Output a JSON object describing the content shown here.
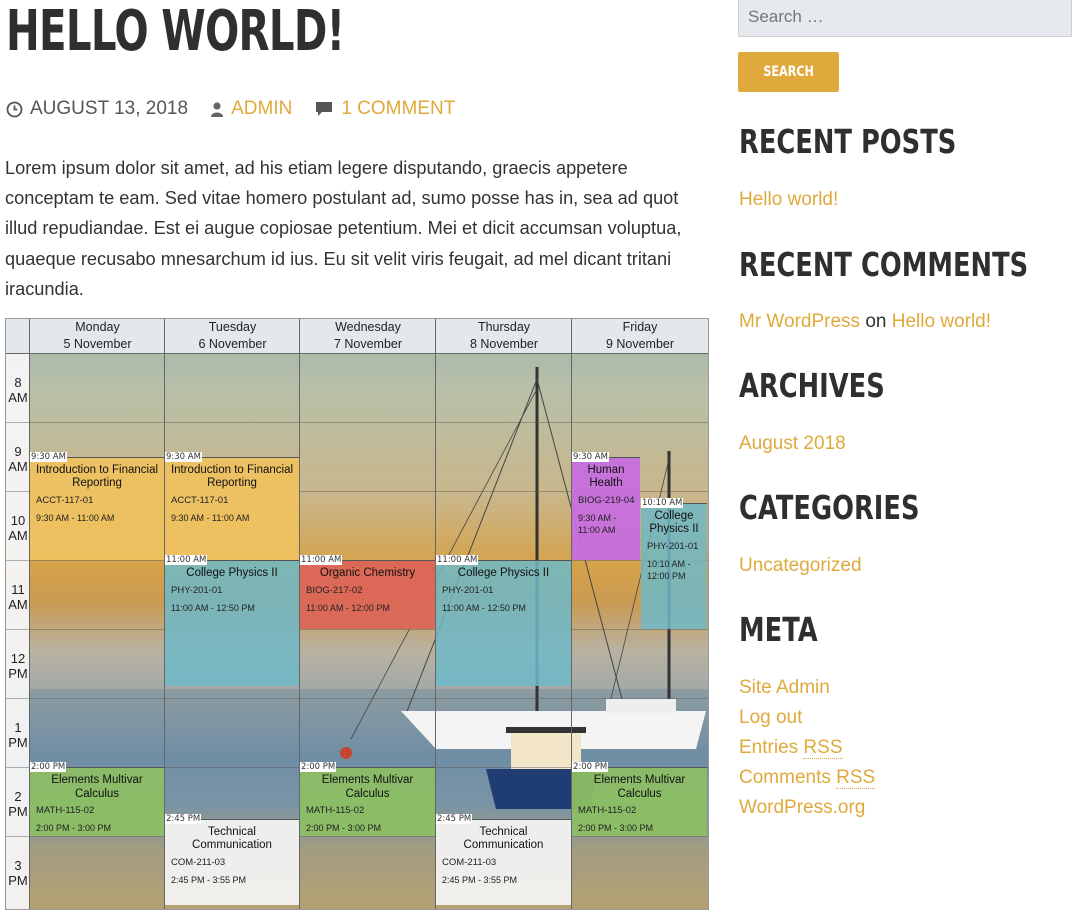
{
  "post": {
    "title": "HELLO WORLD!",
    "date": "AUGUST 13, 2018",
    "author": "ADMIN",
    "comments": "1 COMMENT",
    "content": "Lorem ipsum dolor sit amet, ad his etiam legere disputando, graecis appetere conceptam te eam. Sed vitae homero postulant ad, sumo posse has in, sea ad quot illud repudiandae. Est ei augue copiosae petentium. Mei et dicit accumsan voluptua, quaeque recusabo mnesarchum id ius. Eu sit velit viris feugait, ad mel dicant tritani iracundia."
  },
  "timetable": {
    "days": [
      {
        "name": "Monday",
        "date": "5 November"
      },
      {
        "name": "Tuesday",
        "date": "6 November"
      },
      {
        "name": "Wednesday",
        "date": "7 November"
      },
      {
        "name": "Thursday",
        "date": "8 November"
      },
      {
        "name": "Friday",
        "date": "9 November"
      }
    ],
    "hours": [
      {
        "h": "8",
        "p": "AM"
      },
      {
        "h": "9",
        "p": "AM"
      },
      {
        "h": "10",
        "p": "AM"
      },
      {
        "h": "11",
        "p": "AM"
      },
      {
        "h": "12",
        "p": "PM"
      },
      {
        "h": "1",
        "p": "PM"
      },
      {
        "h": "2",
        "p": "PM"
      },
      {
        "h": "3",
        "p": "PM"
      }
    ],
    "events": [
      {
        "day": 0,
        "start": 9.5,
        "end": 11,
        "stamp": "9:30 AM",
        "title": "Introduction to Financial Reporting",
        "code": "ACCT-117-01",
        "time": "9:30 AM - 11:00 AM",
        "color": "gold"
      },
      {
        "day": 1,
        "start": 9.5,
        "end": 11,
        "stamp": "9:30 AM",
        "title": "Introduction to Financial Reporting",
        "code": "ACCT-117-01",
        "time": "9:30 AM - 11:00 AM",
        "color": "gold"
      },
      {
        "day": 1,
        "start": 11,
        "end": 12.833,
        "stamp": "11:00 AM",
        "title": "College Physics II",
        "code": "PHY-201-01",
        "time": "11:00 AM - 12:50 PM",
        "color": "teal"
      },
      {
        "day": 2,
        "start": 11,
        "end": 12,
        "stamp": "11:00 AM",
        "title": "Organic Chemistry",
        "code": "BIOG-217-02",
        "time": "11:00 AM - 12:00 PM",
        "color": "red"
      },
      {
        "day": 3,
        "start": 11,
        "end": 12.833,
        "stamp": "11:00 AM",
        "title": "College Physics II",
        "code": "PHY-201-01",
        "time": "11:00 AM - 12:50 PM",
        "color": "teal"
      },
      {
        "day": 4,
        "half": "left",
        "start": 9.5,
        "end": 11,
        "stamp": "9:30 AM",
        "title": "Human Health",
        "code": "BIOG-219-04",
        "time": "9:30 AM - 11:00 AM",
        "color": "purple"
      },
      {
        "day": 4,
        "half": "right",
        "start": 10.167,
        "end": 12,
        "stamp": "10:10 AM",
        "title": "College Physics II",
        "code": "PHY-201-01",
        "time": "10:10 AM - 12:00 PM",
        "color": "teal"
      },
      {
        "day": 0,
        "start": 14,
        "end": 15,
        "stamp": "2:00 PM",
        "title": "Elements Multivar Calculus",
        "code": "MATH-115-02",
        "time": "2:00 PM - 3:00 PM",
        "color": "green"
      },
      {
        "day": 2,
        "start": 14,
        "end": 15,
        "stamp": "2:00 PM",
        "title": "Elements Multivar Calculus",
        "code": "MATH-115-02",
        "time": "2:00 PM - 3:00 PM",
        "color": "green"
      },
      {
        "day": 4,
        "start": 14,
        "end": 15,
        "stamp": "2:00 PM",
        "title": "Elements Multivar Calculus",
        "code": "MATH-115-02",
        "time": "2:00 PM - 3:00 PM",
        "color": "green"
      },
      {
        "day": 1,
        "start": 14.75,
        "end": 16,
        "stamp": "2:45 PM",
        "title": "Technical Communication",
        "code": "COM-211-03",
        "time": "2:45 PM - 3:55 PM",
        "color": "white"
      },
      {
        "day": 3,
        "start": 14.75,
        "end": 16,
        "stamp": "2:45 PM",
        "title": "Technical Communication",
        "code": "COM-211-03",
        "time": "2:45 PM - 3:55 PM",
        "color": "white"
      }
    ]
  },
  "sidebar": {
    "search_placeholder": "Search …",
    "search_button": "SEARCH",
    "recent_posts_title": "RECENT POSTS",
    "recent_posts": [
      "Hello world!"
    ],
    "recent_comments_title": "RECENT COMMENTS",
    "comment_author": "Mr WordPress",
    "comment_on": "on",
    "comment_post": "Hello world!",
    "archives_title": "ARCHIVES",
    "archives": [
      "August 2018"
    ],
    "categories_title": "CATEGORIES",
    "categories": [
      "Uncategorized"
    ],
    "meta_title": "META",
    "meta": {
      "site_admin": "Site Admin",
      "log_out": "Log out",
      "entries": "Entries",
      "comments": "Comments",
      "rss": "RSS",
      "wordpress": "WordPress.org"
    }
  },
  "colors": {
    "accent": "#e0a93b",
    "text": "#333333",
    "gold": "#f0c15e",
    "teal": "#6eb9c8",
    "red": "#dc6658",
    "green": "#8cbe64",
    "white": "#f5f5f5",
    "purple": "#c66ede"
  },
  "icons": {
    "date": "clock-icon",
    "author": "person-icon",
    "comments": "comment-bubble-icon"
  }
}
